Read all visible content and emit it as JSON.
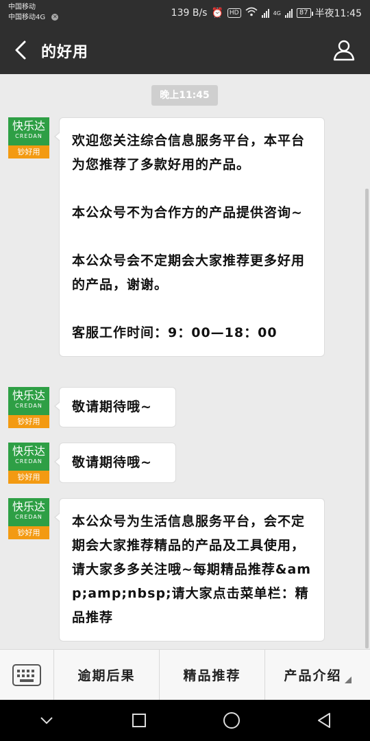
{
  "status_bar": {
    "carrier1": "中国移动",
    "carrier2": "中国移动4G",
    "speed": "139 B/s",
    "hd": "HD",
    "signal_tag": "4G",
    "battery": "87",
    "time": "半夜11:45"
  },
  "header": {
    "title": "的好用"
  },
  "chat": {
    "timestamp": "晚上11:45",
    "avatar": {
      "name": "快乐达",
      "en": "CREDAN",
      "tag": "钞好用",
      "colors": {
        "green": "#2e9f45",
        "orange": "#f39a12"
      }
    },
    "messages": [
      {
        "paragraphs": [
          "欢迎您关注综合信息服务平台，本平台为您推荐了多款好用的产品。",
          "本公众号不为合作方的产品提供咨询~",
          "本公众号会不定期会大家推荐更多好用的产品，谢谢。",
          "客服工作时间：9：00—18：00"
        ]
      },
      {
        "paragraphs": [
          "敬请期待哦~"
        ]
      },
      {
        "paragraphs": [
          "敬请期待哦~"
        ]
      },
      {
        "paragraphs": [
          "本公众号为生活信息服务平台，会不定期会大家推荐精品的产品及工具使用，请大家多多关注哦~每期精品推荐&amp;amp;nbsp;请大家点击菜单栏：精品推荐"
        ]
      }
    ]
  },
  "menu": {
    "items": [
      "逾期后果",
      "精品推荐",
      "产品介绍"
    ]
  },
  "icons": {
    "back": "back-arrow-icon",
    "profile": "person-icon",
    "keyboard": "keyboard-icon",
    "nav": [
      "nav-back-icon",
      "home-icon",
      "recents-icon"
    ]
  }
}
